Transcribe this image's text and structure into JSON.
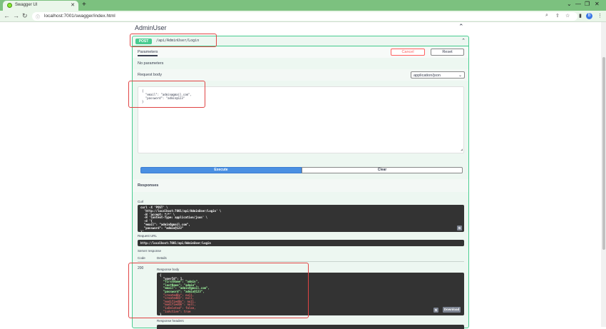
{
  "browser": {
    "tab_title": "Swagger UI",
    "url": "localhost:7001/swagger/index.html",
    "profile_initial": "B"
  },
  "section": {
    "title": "AdminUser"
  },
  "operation": {
    "method": "POST",
    "path": "/api/AdminUser/Login",
    "parameters_tab": "Parameters",
    "cancel_label": "Cancel",
    "reset_label": "Reset",
    "no_parameters": "No parameters",
    "request_body_label": "Request body",
    "content_type": "application/json",
    "request_body_text": "{\n  \"email\": \"admin@gmail.com\",\n  \"password\": \"admin@123\"\n}",
    "execute_label": "Execute",
    "clear_label": "Clear"
  },
  "responses": {
    "title": "Responses",
    "curl_label": "Curl",
    "curl_text": "curl -X 'POST' \\\n  'http://localhost:7001/api/AdminUser/Login' \\\n  -H 'accept: */*' \\\n  -H 'Content-Type: application/json' \\\n  -d '{\n  \"email\": \"admin@gmail.com\",\n  \"password\": \"admin@123\"\n}'",
    "request_url_label": "Request URL",
    "request_url": "http://localhost:7001/api/AdminUser/Login",
    "server_response_label": "Server response",
    "code_header": "Code",
    "details_header": "Details",
    "status_code": "200",
    "response_body_label": "Response body",
    "response_body_lines": [
      "{",
      "  \"userId\": 1,",
      "  \"firstName\": \"admin\",",
      "  \"lastName\": \"admin\",",
      "  \"email\": \"admin@gmail.com\",",
      "  \"password\": \"admin@123\",",
      "  \"createdBy\": null,",
      "  \"createdOn\": null,",
      "  \"modifiedBy\": null,",
      "  \"modifiedOn\": null,",
      "  \"isDeleted\": false,",
      "  \"isActive\": true",
      "}"
    ],
    "download_label": "Download",
    "response_headers_label": "Response headers"
  },
  "colors": {
    "post_green": "#49cc90",
    "execute_blue": "#4990e2",
    "highlight_red": "#e04444"
  }
}
